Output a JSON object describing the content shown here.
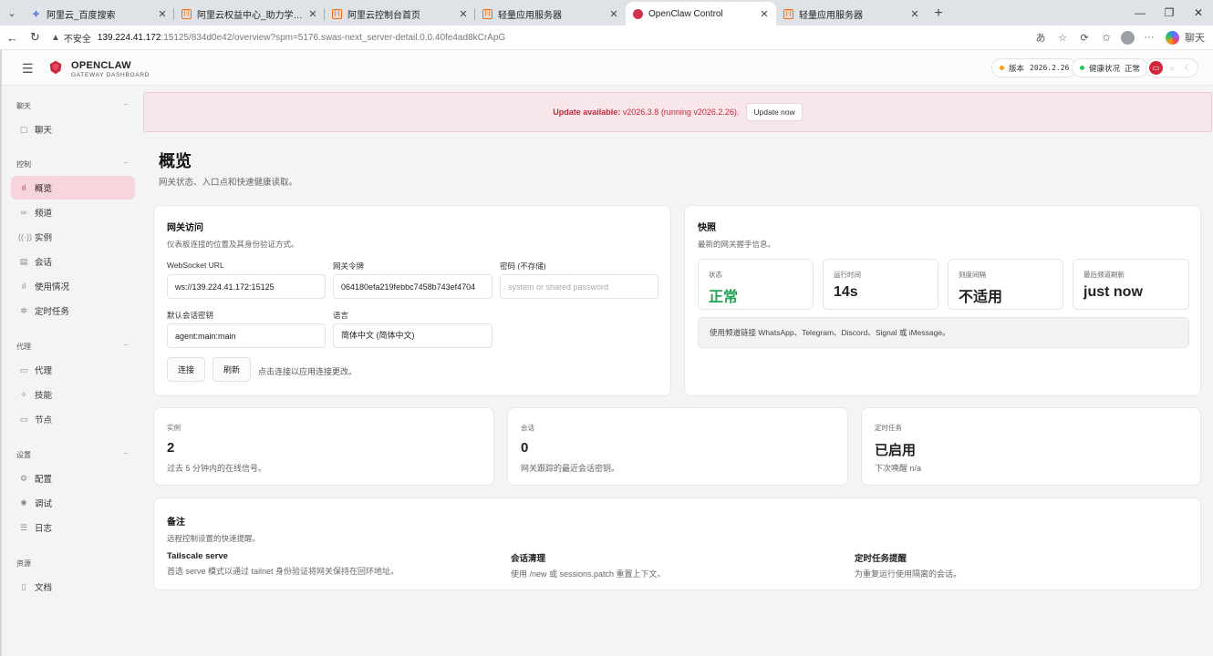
{
  "browser": {
    "tabs": [
      {
        "label": "阿里云_百度搜索",
        "favicon": "baidu"
      },
      {
        "label": "阿里云权益中心_助力学生、开发者",
        "favicon": "aliyun"
      },
      {
        "label": "阿里云控制台首页",
        "favicon": "aliyun"
      },
      {
        "label": "轻量应用服务器",
        "favicon": "aliyun"
      },
      {
        "label": "OpenClaw Control",
        "favicon": "openclaw",
        "active": true
      },
      {
        "label": "轻量应用服务器",
        "favicon": "aliyun"
      }
    ],
    "address": {
      "insecure_label": "不安全",
      "host": "139.224.41.172",
      "path": ":15125/834d0e42/overview?spm=5176.swas-next_server-detail.0.0.40fe4ad8kCrApG"
    },
    "copilot_label": "聊天"
  },
  "app": {
    "brand": {
      "title": "OPENCLAW",
      "subtitle": "GATEWAY DASHBOARD"
    },
    "version_pill": {
      "label": "版本",
      "value": "2026.2.26",
      "dot_color": "#f59e0b"
    },
    "health_pill": {
      "label": "健康状况",
      "value": "正常",
      "dot_color": "#22c55e"
    },
    "accent": "#d3263c"
  },
  "sidebar": {
    "sections": [
      {
        "title": "聊天",
        "items": [
          {
            "label": "聊天",
            "icon": "chat-icon"
          }
        ]
      },
      {
        "title": "控制",
        "items": [
          {
            "label": "概览",
            "icon": "bar-chart-icon",
            "active": true
          },
          {
            "label": "频道",
            "icon": "link-icon"
          },
          {
            "label": "实例",
            "icon": "radio-icon"
          },
          {
            "label": "会话",
            "icon": "document-icon"
          },
          {
            "label": "使用情况",
            "icon": "bar-chart-icon"
          },
          {
            "label": "定时任务",
            "icon": "clock-icon"
          }
        ]
      },
      {
        "title": "代理",
        "items": [
          {
            "label": "代理",
            "icon": "folder-icon"
          },
          {
            "label": "技能",
            "icon": "bolt-icon"
          },
          {
            "label": "节点",
            "icon": "monitor-icon"
          }
        ]
      },
      {
        "title": "设置",
        "items": [
          {
            "label": "配置",
            "icon": "gear-icon"
          },
          {
            "label": "调试",
            "icon": "bug-icon"
          },
          {
            "label": "日志",
            "icon": "log-icon"
          }
        ]
      },
      {
        "title": "资源",
        "items": [
          {
            "label": "文档",
            "icon": "book-icon"
          }
        ]
      }
    ]
  },
  "banner": {
    "label": "Update available:",
    "text": "v2026.3.8 (running v2026.2.26).",
    "button": "Update now"
  },
  "page": {
    "title": "概览",
    "subtitle": "网关状态、入口点和快速健康读取。"
  },
  "gateway": {
    "title": "网关访问",
    "subtitle": "仪表板连接的位置及其身份验证方式。",
    "ws_label": "WebSocket URL",
    "ws_value": "ws://139.224.41.172:15125",
    "token_label": "网关令牌",
    "token_value": "064180efa219febbc7458b743ef4704",
    "password_label": "密码 (不存储)",
    "password_placeholder": "system or shared password",
    "session_key_label": "默认会话密钥",
    "session_key_value": "agent:main:main",
    "language_label": "语言",
    "language_value": "简体中文 (简体中文)",
    "connect_button": "连接",
    "refresh_button": "刷新",
    "hint": "点击连接以应用连接更改。"
  },
  "snapshot": {
    "title": "快照",
    "subtitle": "最新的网关握手信息。",
    "stats": [
      {
        "label": "状态",
        "value": "正常",
        "ok": true
      },
      {
        "label": "运行时间",
        "value": "14s"
      },
      {
        "label": "刻度间隔",
        "value": "不适用"
      },
      {
        "label": "最后频道刷新",
        "value": "just now"
      }
    ],
    "note": "使用频道链接 WhatsApp、Telegram、Discord、Signal 或 iMessage。"
  },
  "metrics": [
    {
      "label": "实例",
      "value": "2",
      "sub": "过去 5 分钟内的在线信号。"
    },
    {
      "label": "会话",
      "value": "0",
      "sub": "网关跟踪的最近会话密钥。"
    },
    {
      "label": "定时任务",
      "value": "已启用",
      "sub": "下次唤醒 n/a"
    }
  ],
  "notes": {
    "title": "备注",
    "subtitle": "远程控制设置的快速提醒。",
    "items": [
      {
        "title": "Tailscale serve",
        "desc": "首选 serve 模式以通过 tailnet 身份验证将网关保持在回环地址。"
      },
      {
        "title": "会话清理",
        "desc": "使用 /new 或 sessions.patch 重置上下文。"
      },
      {
        "title": "定时任务提醒",
        "desc": "为重复运行使用隔离的会话。"
      }
    ]
  }
}
